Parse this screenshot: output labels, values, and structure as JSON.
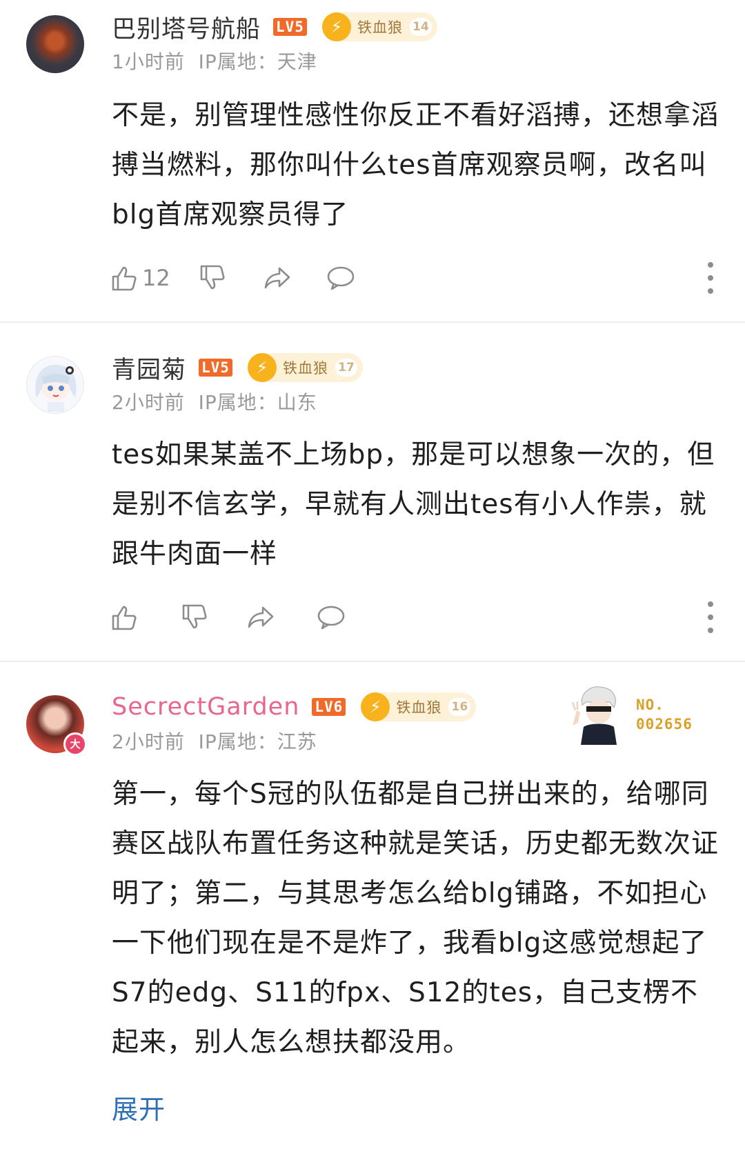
{
  "comments": [
    {
      "username": "巴别塔号航船",
      "level": "LV5",
      "fan_badge": {
        "name": "铁血狼",
        "level": "14"
      },
      "time": "1小时前",
      "ip": "IP属地：天津",
      "text": "不是，别管理性感性你反正不看好滔搏，还想拿滔搏当燃料，那你叫什么tes首席观察员啊，改名叫blg首席观察员得了",
      "likes": "12",
      "avatar_icon": "avatar-dark-icon"
    },
    {
      "username": "青园菊",
      "level": "LV5",
      "fan_badge": {
        "name": "铁血狼",
        "level": "17"
      },
      "time": "2小时前",
      "ip": "IP属地：山东",
      "text": "tes如果某盖不上场bp，那是可以想象一次的，但是别不信玄学，早就有人测出tes有小人作祟，就跟牛肉面一样",
      "likes": "",
      "avatar_icon": "anime-girl-avatar-icon"
    },
    {
      "username": "SecrectGarden",
      "level": "LV6",
      "fan_badge": {
        "name": "铁血狼",
        "level": "16"
      },
      "time": "2小时前",
      "ip": "IP属地：江苏",
      "text": "第一，每个S冠的队伍都是自己拼出来的，给哪同赛区战队布置任务这种就是笑话，历史都无数次证明了；第二，与其思考怎么给blg铺路，不如担心一下他们现在是不是炸了，我看blg这感觉想起了S7的edg、S11的fpx、S12的tes，自己支楞不起来，别人怎么想扶都没用。",
      "vip_mark": "大",
      "medal_no": [
        "NO.",
        "002656"
      ],
      "expand_label": "展开",
      "avatar_icon": "photo-avatar-icon"
    }
  ],
  "colors": {
    "level_badge": "#f06b2a",
    "fan_badge_bg": "#fdf1d8",
    "fan_icon": "#f7b21c",
    "link": "#2f6fb3",
    "pink_name": "#e9668a"
  }
}
